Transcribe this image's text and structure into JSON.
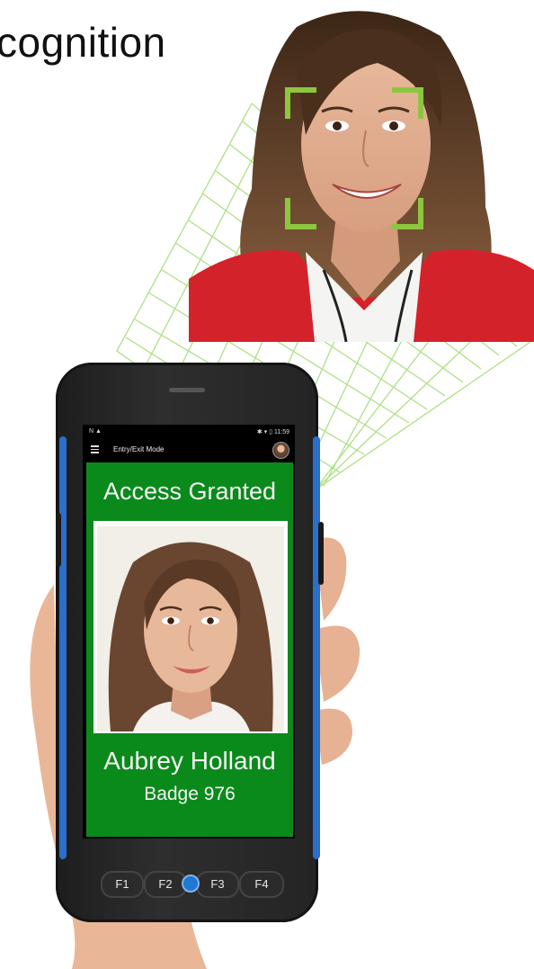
{
  "headline": "cognition",
  "phone": {
    "status_left": "N ▲",
    "status_right": "✱ ▾ ▯ 11:59",
    "mode_title": "Entry/Exit Mode",
    "result_text": "Access Granted",
    "person_name": "Aubrey Holland",
    "badge_text": "Badge 976",
    "function_keys": [
      "F1",
      "F2",
      "F3",
      "F4"
    ]
  },
  "colors": {
    "screen_green": "#0b8a1c",
    "face_frame_green": "#8cc63f",
    "grid_green": "#a6dd7a",
    "phone_accent_blue": "#2a6fc9"
  },
  "icons": [
    "menu-icon",
    "user-avatar-icon",
    "scan-button-icon"
  ]
}
